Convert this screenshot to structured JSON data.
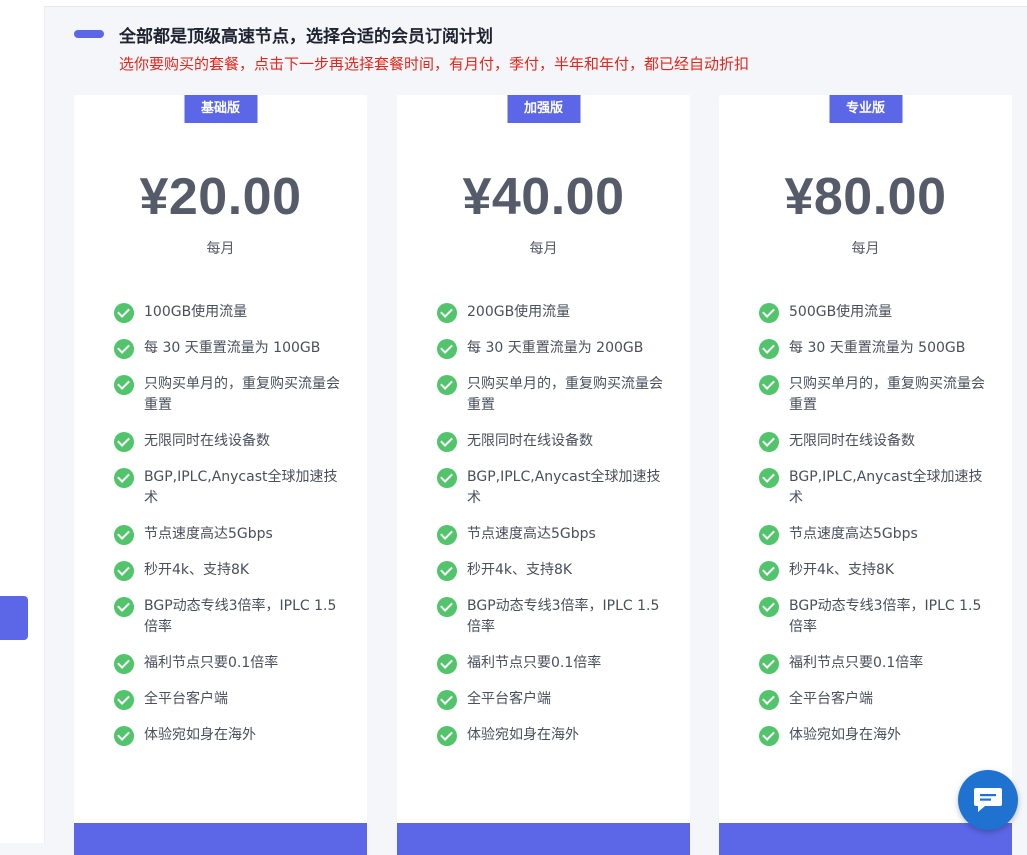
{
  "heading": {
    "title": "全部都是顶级高速节点，选择合适的会员订阅计划",
    "subtitle": "选你要购买的套餐，点击下一步再选择套餐时间，有月付，季付，半年和年付，都已经自动折扣"
  },
  "plans": [
    {
      "badge": "基础版",
      "price": "¥20.00",
      "period": "每月",
      "features": [
        "100GB使用流量",
        "每 30 天重置流量为 100GB",
        "只购买单月的，重复购买流量会重置",
        "无限同时在线设备数",
        "BGP,IPLC,Anycast全球加速技术",
        "节点速度高达5Gbps",
        "秒开4k、支持8K",
        "BGP动态专线3倍率，IPLC 1.5倍率",
        "福利节点只要0.1倍率",
        "全平台客户端",
        "体验宛如身在海外"
      ]
    },
    {
      "badge": "加强版",
      "price": "¥40.00",
      "period": "每月",
      "features": [
        "200GB使用流量",
        "每 30 天重置流量为 200GB",
        "只购买单月的，重复购买流量会重置",
        "无限同时在线设备数",
        "BGP,IPLC,Anycast全球加速技术",
        "节点速度高达5Gbps",
        "秒开4k、支持8K",
        "BGP动态专线3倍率，IPLC 1.5倍率",
        "福利节点只要0.1倍率",
        "全平台客户端",
        "体验宛如身在海外"
      ]
    },
    {
      "badge": "专业版",
      "price": "¥80.00",
      "period": "每月",
      "features": [
        "500GB使用流量",
        "每 30 天重置流量为 500GB",
        "只购买单月的，重复购买流量会重置",
        "无限同时在线设备数",
        "BGP,IPLC,Anycast全球加速技术",
        "节点速度高达5Gbps",
        "秒开4k、支持8K",
        "BGP动态专线3倍率，IPLC 1.5倍率",
        "福利节点只要0.1倍率",
        "全平台客户端",
        "体验宛如身在海外"
      ]
    }
  ],
  "colors": {
    "accent": "#5b67e6",
    "check": "#52c46b",
    "subtitle": "#e3261b",
    "chat": "#1f72cf"
  },
  "icons": {
    "feature": "check-circle-icon",
    "chat": "chat-bubble-icon"
  }
}
